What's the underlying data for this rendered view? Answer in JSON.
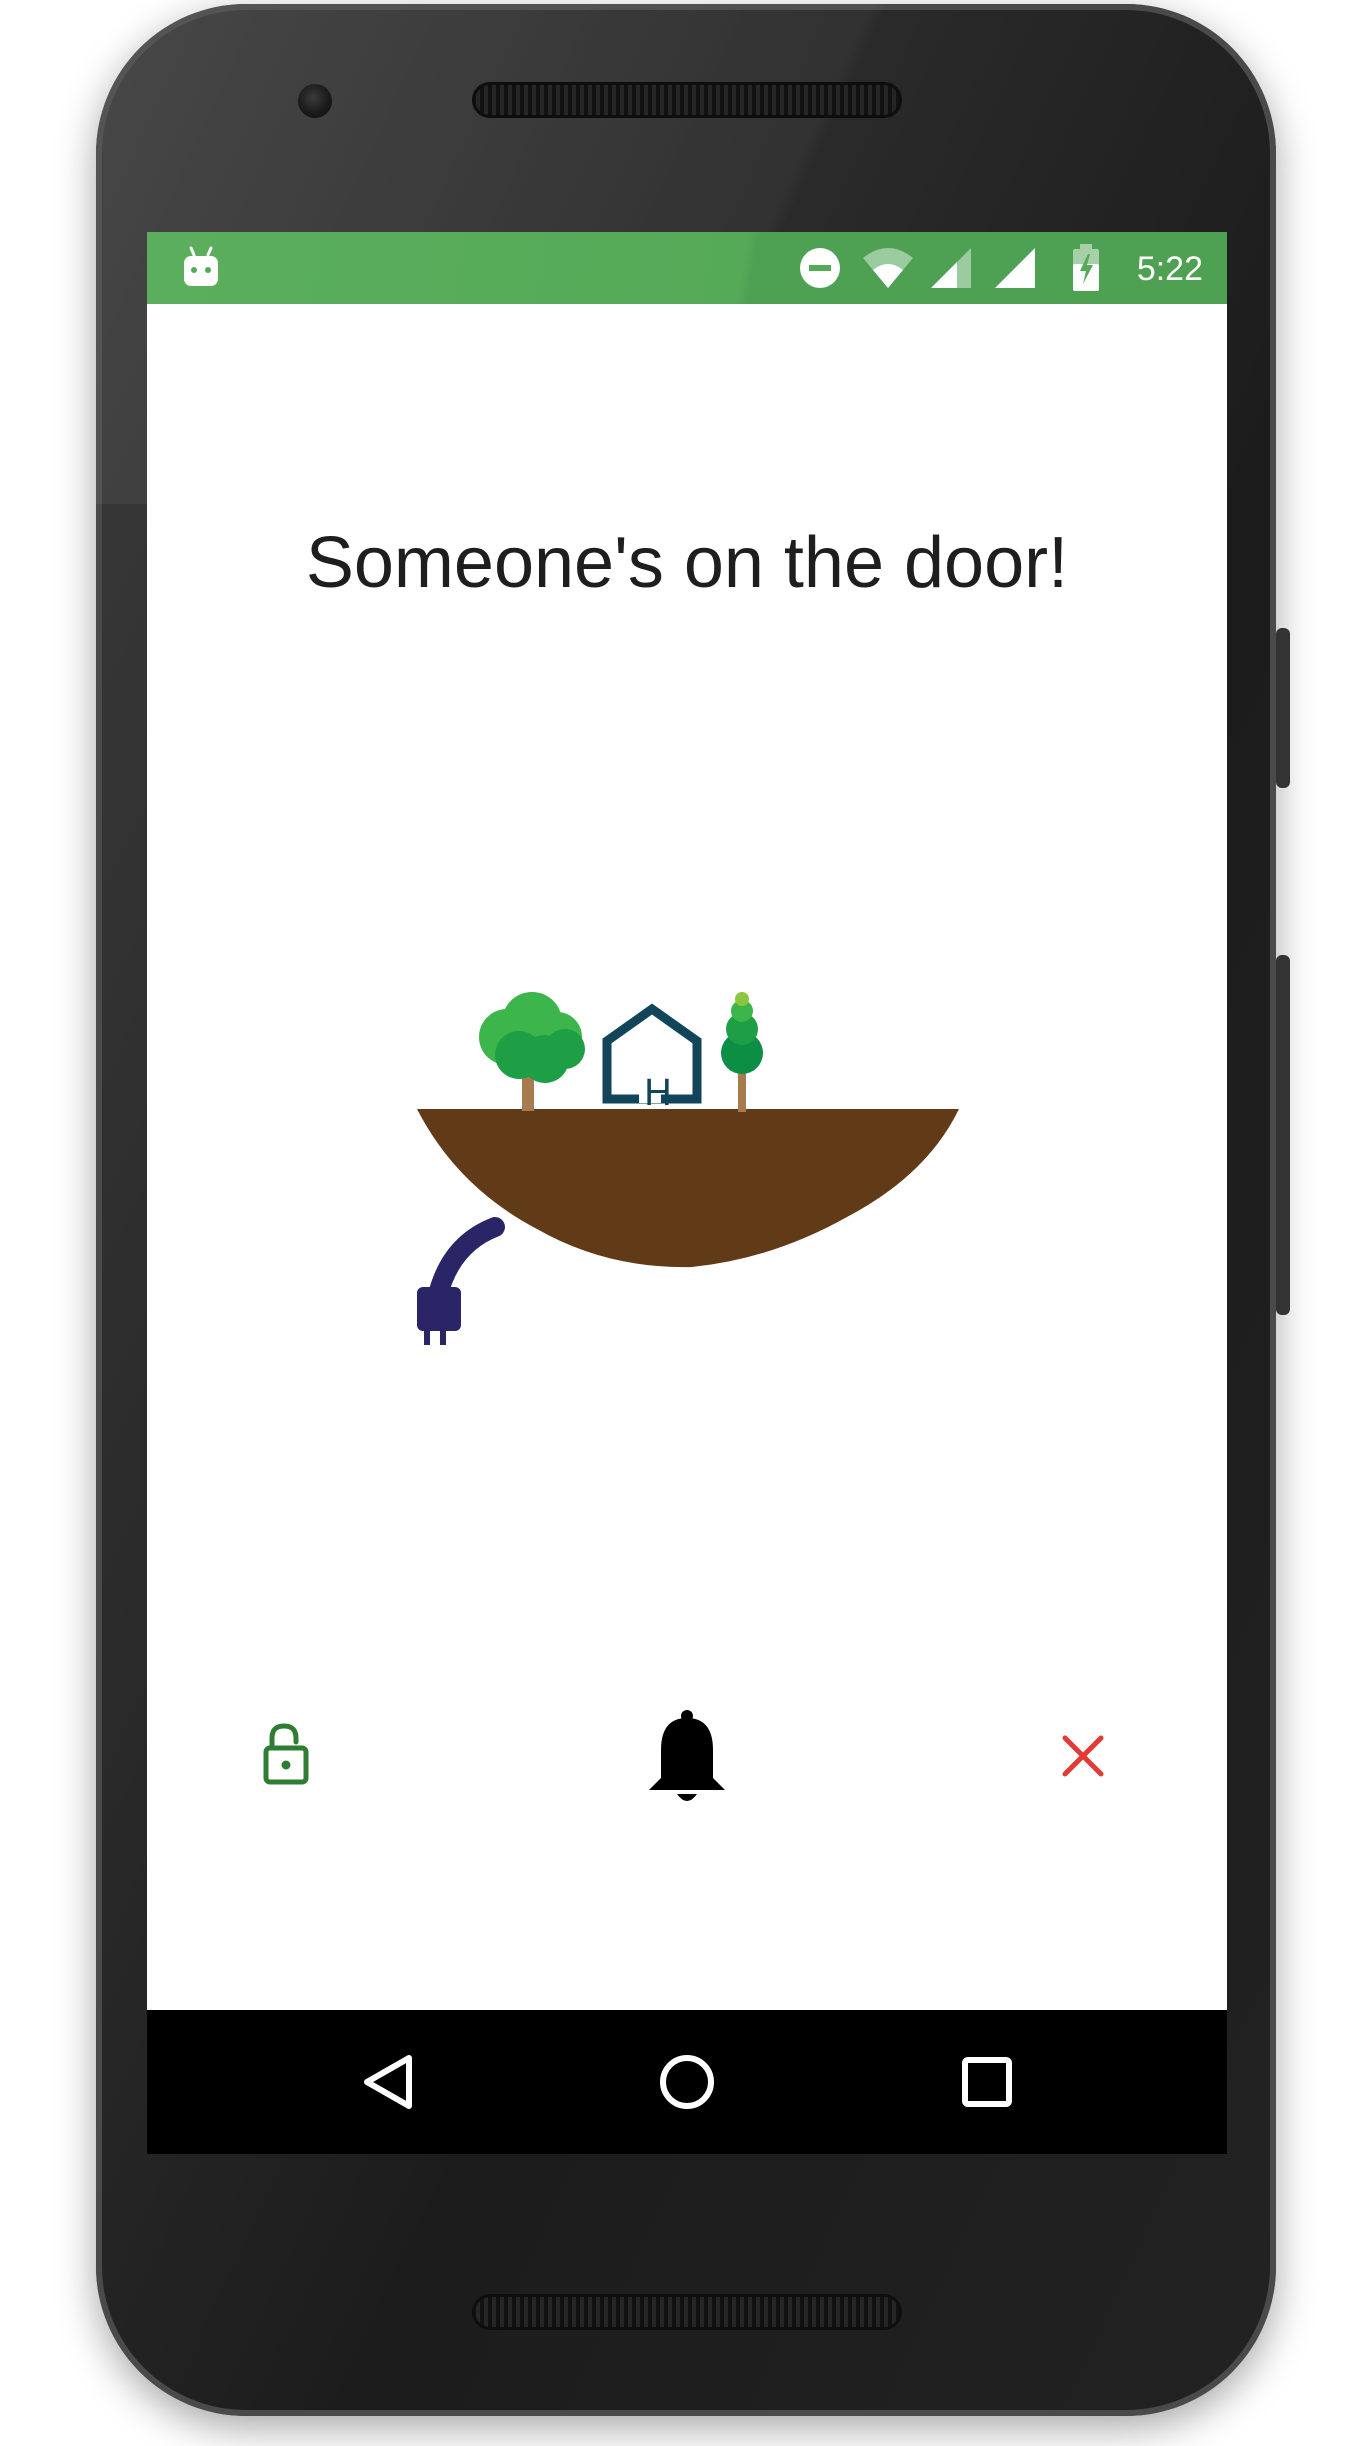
{
  "status_bar": {
    "time": "5:22",
    "icons": [
      "android-debug-icon",
      "do-not-disturb-icon",
      "wifi-icon",
      "signal-icon",
      "signal-full-icon",
      "battery-charging-icon"
    ],
    "color": "#55aa58"
  },
  "main": {
    "title": "Someone's on the door!",
    "illustration": "floating-island-home-logo",
    "actions": {
      "unlock": {
        "icon": "unlock-icon",
        "color": "#2e7d32"
      },
      "ring": {
        "icon": "bell-icon",
        "color": "#000000"
      },
      "dismiss": {
        "icon": "close-icon",
        "color": "#e53935"
      }
    }
  },
  "nav_bar": {
    "back": "back-icon",
    "home": "home-icon",
    "recents": "recents-icon"
  }
}
